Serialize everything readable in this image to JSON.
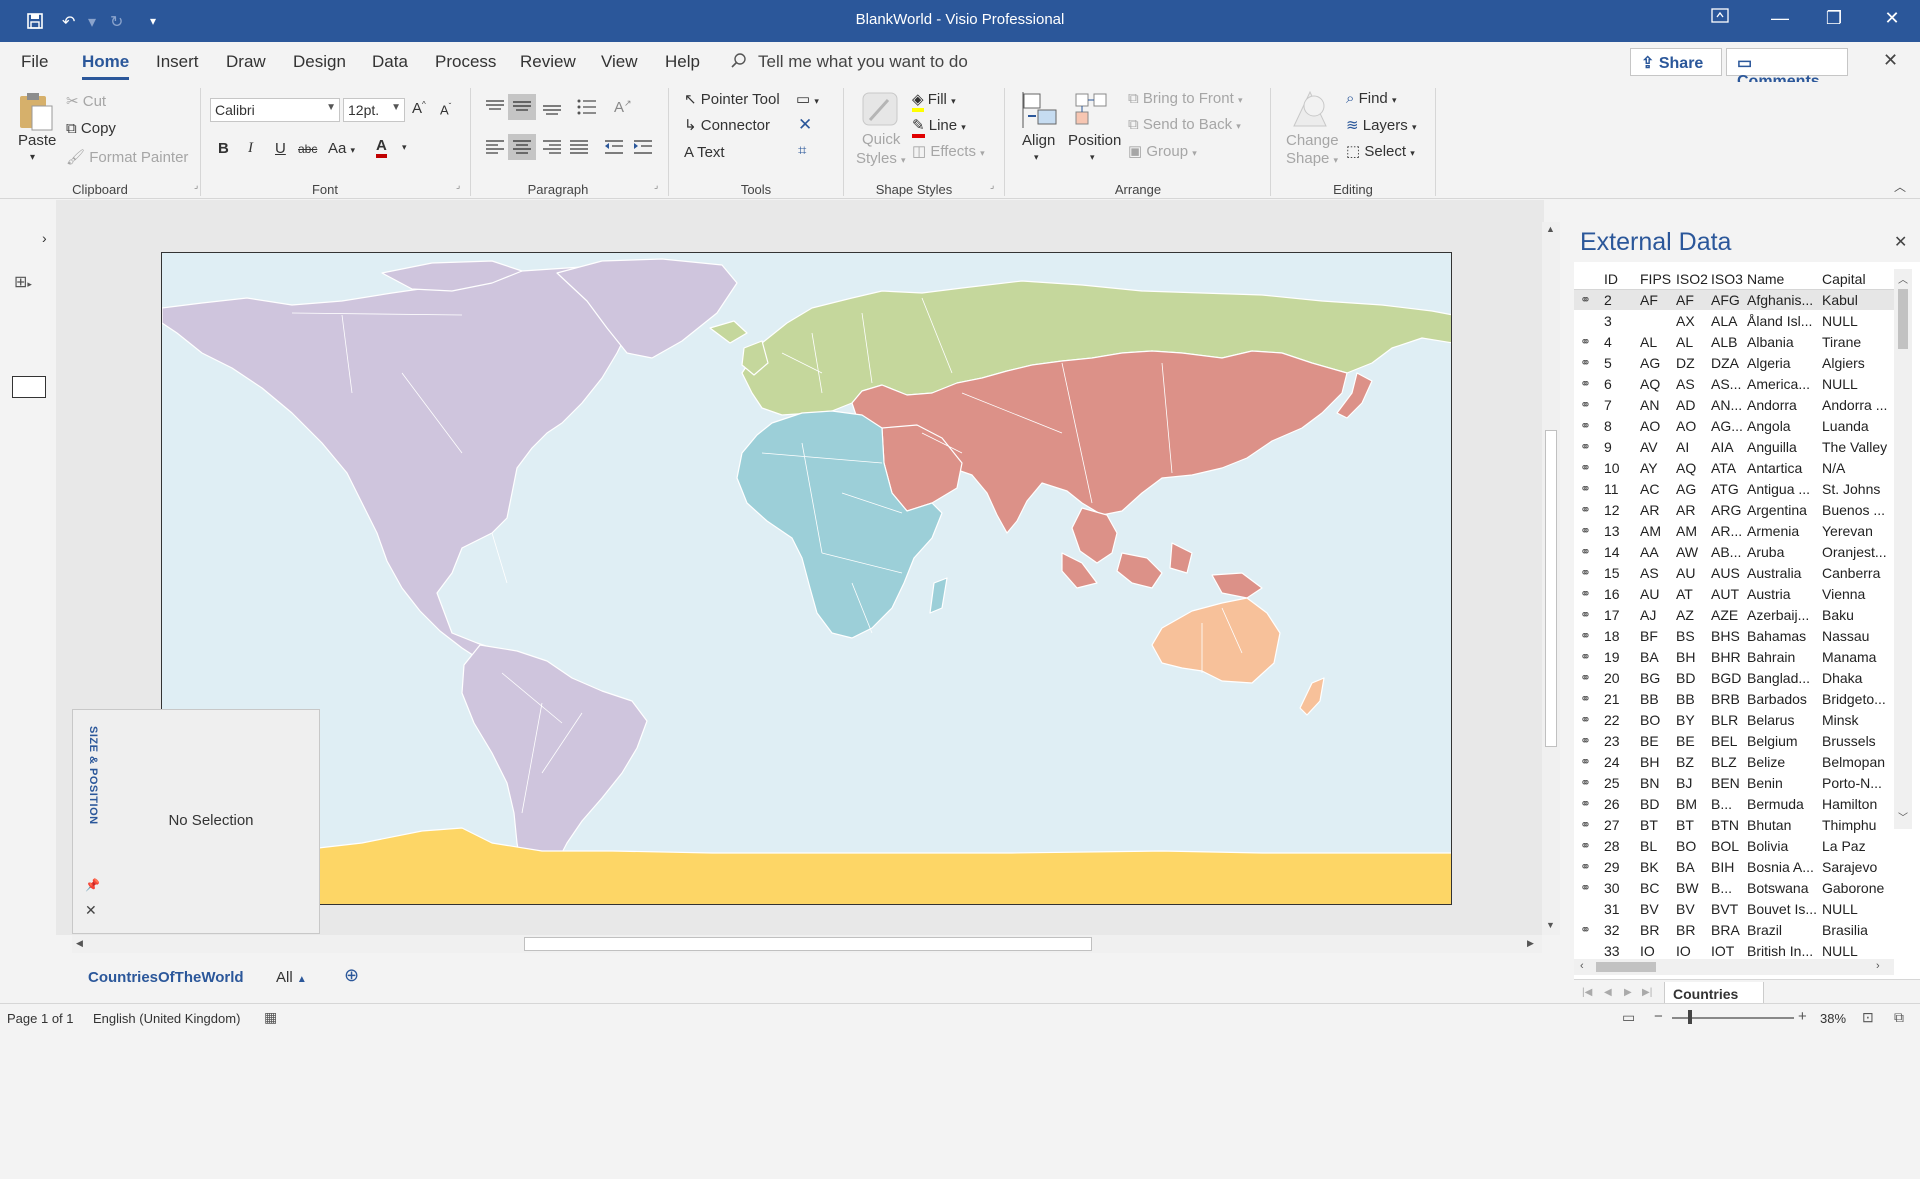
{
  "window": {
    "title": "BlankWorld  -  Visio Professional"
  },
  "menu_tabs": [
    "File",
    "Home",
    "Insert",
    "Draw",
    "Design",
    "Data",
    "Process",
    "Review",
    "View",
    "Help"
  ],
  "active_tab": "Home",
  "tell_me": "Tell me what you want to do",
  "share_label": "Share",
  "comments_label": "Comments",
  "ribbon": {
    "clipboard": {
      "paste": "Paste",
      "cut": "Cut",
      "copy": "Copy",
      "format_painter": "Format Painter",
      "group": "Clipboard"
    },
    "font": {
      "name": "Calibri",
      "size": "12pt.",
      "case": "Aa",
      "group": "Font"
    },
    "paragraph": {
      "group": "Paragraph"
    },
    "tools": {
      "pointer": "Pointer Tool",
      "connector": "Connector",
      "text": "Text",
      "group": "Tools"
    },
    "shape_styles": {
      "quick": "Quick",
      "styles": "Styles",
      "fill": "Fill",
      "line": "Line",
      "effects": "Effects",
      "group": "Shape Styles"
    },
    "arrange": {
      "align": "Align",
      "position": "Position",
      "bring_front": "Bring to Front",
      "send_back": "Send to Back",
      "group_btn": "Group",
      "group": "Arrange"
    },
    "editing": {
      "change": "Change",
      "shape": "Shape",
      "find": "Find",
      "layers": "Layers",
      "select": "Select",
      "group": "Editing"
    }
  },
  "size_position": {
    "title": "SIZE & POSITION",
    "status": "No Selection"
  },
  "external_data": {
    "title": "External Data",
    "columns": [
      "ID",
      "FIPS",
      "ISO2",
      "ISO3",
      "Name",
      "Capital"
    ],
    "rows": [
      [
        "2",
        "AF",
        "AF",
        "AFG",
        "Afghanis...",
        "Kabul",
        true
      ],
      [
        "3",
        "",
        "AX",
        "ALA",
        "Åland Isl...",
        "NULL",
        false
      ],
      [
        "4",
        "AL",
        "AL",
        "ALB",
        "Albania",
        "Tirane",
        true
      ],
      [
        "5",
        "AG",
        "DZ",
        "DZA",
        "Algeria",
        "Algiers",
        true
      ],
      [
        "6",
        "AQ",
        "AS",
        "AS...",
        "America...",
        "NULL",
        true
      ],
      [
        "7",
        "AN",
        "AD",
        "AN...",
        "Andorra",
        "Andorra ...",
        true
      ],
      [
        "8",
        "AO",
        "AO",
        "AG...",
        "Angola",
        "Luanda",
        true
      ],
      [
        "9",
        "AV",
        "AI",
        "AIA",
        "Anguilla",
        "The Valley",
        true
      ],
      [
        "10",
        "AY",
        "AQ",
        "ATA",
        "Antartica",
        "N/A",
        true
      ],
      [
        "11",
        "AC",
        "AG",
        "ATG",
        "Antigua ...",
        "St. Johns",
        true
      ],
      [
        "12",
        "AR",
        "AR",
        "ARG",
        "Argentina",
        "Buenos ...",
        true
      ],
      [
        "13",
        "AM",
        "AM",
        "AR...",
        "Armenia",
        "Yerevan",
        true
      ],
      [
        "14",
        "AA",
        "AW",
        "AB...",
        "Aruba",
        "Oranjest...",
        true
      ],
      [
        "15",
        "AS",
        "AU",
        "AUS",
        "Australia",
        "Canberra",
        true
      ],
      [
        "16",
        "AU",
        "AT",
        "AUT",
        "Austria",
        "Vienna",
        true
      ],
      [
        "17",
        "AJ",
        "AZ",
        "AZE",
        "Azerbaij...",
        "Baku",
        true
      ],
      [
        "18",
        "BF",
        "BS",
        "BHS",
        "Bahamas",
        "Nassau",
        true
      ],
      [
        "19",
        "BA",
        "BH",
        "BHR",
        "Bahrain",
        "Manama",
        true
      ],
      [
        "20",
        "BG",
        "BD",
        "BGD",
        "Banglad...",
        "Dhaka",
        true
      ],
      [
        "21",
        "BB",
        "BB",
        "BRB",
        "Barbados",
        "Bridgeto...",
        true
      ],
      [
        "22",
        "BO",
        "BY",
        "BLR",
        "Belarus",
        "Minsk",
        true
      ],
      [
        "23",
        "BE",
        "BE",
        "BEL",
        "Belgium",
        "Brussels",
        true
      ],
      [
        "24",
        "BH",
        "BZ",
        "BLZ",
        "Belize",
        "Belmopan",
        true
      ],
      [
        "25",
        "BN",
        "BJ",
        "BEN",
        "Benin",
        "Porto-N...",
        true
      ],
      [
        "26",
        "BD",
        "BM",
        "B...",
        "Bermuda",
        "Hamilton",
        true
      ],
      [
        "27",
        "BT",
        "BT",
        "BTN",
        "Bhutan",
        "Thimphu",
        true
      ],
      [
        "28",
        "BL",
        "BO",
        "BOL",
        "Bolivia",
        "La Paz",
        true
      ],
      [
        "29",
        "BK",
        "BA",
        "BIH",
        "Bosnia A...",
        "Sarajevo",
        true
      ],
      [
        "30",
        "BC",
        "BW",
        "B...",
        "Botswana",
        "Gaborone",
        true
      ],
      [
        "31",
        "BV",
        "BV",
        "BVT",
        "Bouvet Is...",
        "NULL",
        false
      ],
      [
        "32",
        "BR",
        "BR",
        "BRA",
        "Brazil",
        "Brasilia",
        true
      ],
      [
        "33",
        "IO",
        "IO",
        "IOT",
        "British In...",
        "NULL",
        false
      ]
    ],
    "sheet_tab": "Countries"
  },
  "page_tabs": {
    "page": "CountriesOfTheWorld",
    "all": "All"
  },
  "status": {
    "page": "Page 1 of 1",
    "language": "English (United Kingdom)",
    "zoom": "38%"
  },
  "colors": {
    "accent": "#2b579a",
    "americas": "#cfc5dd",
    "europe_russia": "#c5d79c",
    "asia": "#dc9188",
    "africa": "#9ccfd8",
    "oceania": "#f7c19a",
    "antarctica": "#fdd666",
    "ocean": "#dfeef4"
  }
}
